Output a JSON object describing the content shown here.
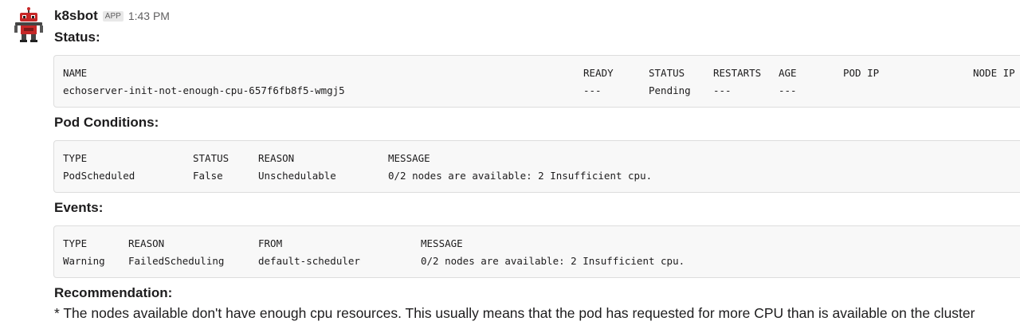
{
  "message": {
    "bot_name": "k8sbot",
    "badge": "APP",
    "timestamp": "1:43 PM"
  },
  "status": {
    "title": "Status:",
    "headers": [
      "NAME",
      "READY",
      "STATUS",
      "RESTARTS",
      "AGE",
      "POD IP",
      "NODE IP"
    ],
    "rows": [
      [
        "echoserver-init-not-enough-cpu-657f6fb8f5-wmgj5",
        "---",
        "Pending",
        "---",
        "---",
        "",
        ""
      ]
    ]
  },
  "pod_conditions": {
    "title": "Pod Conditions:",
    "headers": [
      "TYPE",
      "STATUS",
      "REASON",
      "MESSAGE"
    ],
    "rows": [
      [
        "PodScheduled",
        "False",
        "Unschedulable",
        "0/2 nodes are available: 2 Insufficient cpu."
      ]
    ]
  },
  "events": {
    "title": "Events:",
    "headers": [
      "TYPE",
      "REASON",
      "FROM",
      "MESSAGE"
    ],
    "rows": [
      [
        "Warning",
        "FailedScheduling",
        "default-scheduler",
        "0/2 nodes are available: 2 Insufficient cpu."
      ]
    ]
  },
  "recommendation": {
    "title": "Recommendation:",
    "text": "* The nodes available don't have enough cpu resources.  This usually means that the pod has requested for more CPU than is available on the cluster"
  }
}
